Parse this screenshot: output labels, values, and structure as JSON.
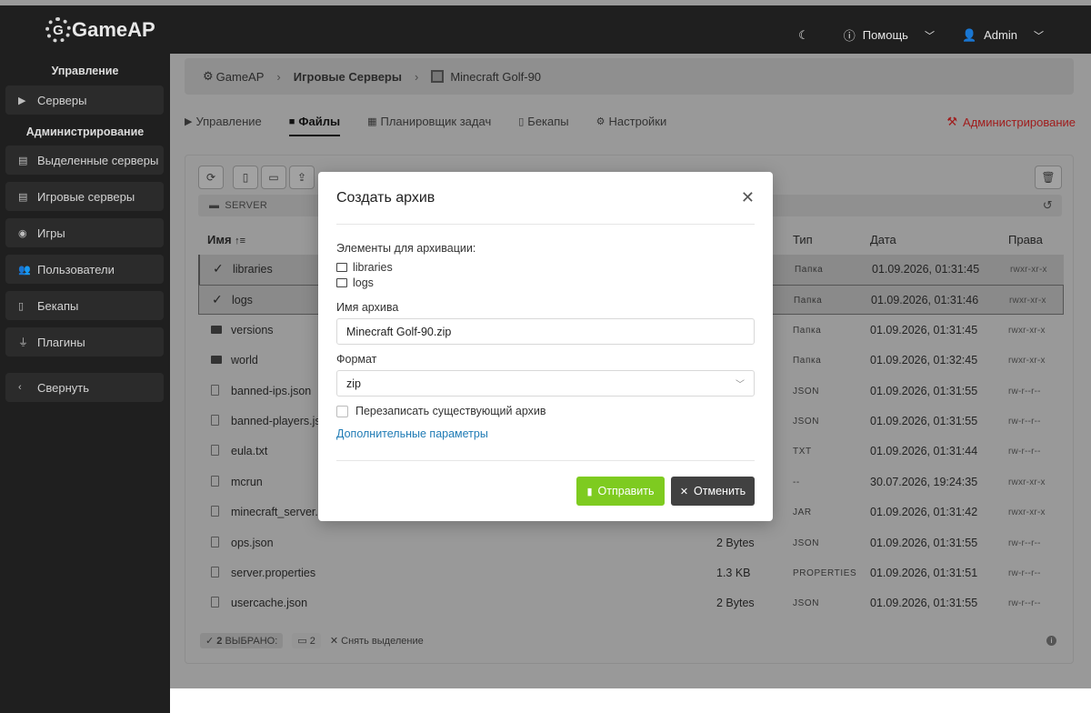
{
  "header": {
    "logo_text": "GameAP",
    "logo_glyph": "G",
    "help_label": "Помощь",
    "user_label": "Admin",
    "icons": {
      "theme": "moon-icon",
      "help": "question-circle-icon",
      "user": "user-icon"
    }
  },
  "sidebar": {
    "section_manage": "Управление",
    "section_admin": "Администрирование",
    "items": [
      {
        "label": "Серверы",
        "icon": "play-icon"
      },
      {
        "label": "Выделенные серверы",
        "icon": "server-icon"
      },
      {
        "label": "Игровые серверы",
        "icon": "server-icon"
      },
      {
        "label": "Игры",
        "icon": "gamepad-icon"
      },
      {
        "label": "Пользователи",
        "icon": "users-icon"
      },
      {
        "label": "Бекапы",
        "icon": "file-archive-icon"
      },
      {
        "label": "Плагины",
        "icon": "plug-icon"
      },
      {
        "label": "Свернуть",
        "icon": "chevron-left-icon"
      }
    ]
  },
  "breadcrumb": {
    "items": [
      "GameAP",
      "Игровые Серверы",
      "Minecraft Golf-90"
    ]
  },
  "tabs": {
    "items": [
      "Управление",
      "Файлы",
      "Планировщик задач",
      "Бекапы",
      "Настройки"
    ],
    "active": "Файлы",
    "admin": "Администрирование"
  },
  "file_manager": {
    "path": "SERVER",
    "columns": {
      "name": "Имя",
      "type": "Тип",
      "date": "Дата",
      "perms": "Права"
    },
    "rows": [
      {
        "name": "libraries",
        "size": "",
        "type": "Папка",
        "date": "01.09.2026, 01:31:45",
        "perms": "rwxr-xr-x",
        "kind": "folder",
        "selected": true
      },
      {
        "name": "logs",
        "size": "",
        "type": "Папка",
        "date": "01.09.2026, 01:31:46",
        "perms": "rwxr-xr-x",
        "kind": "folder",
        "selected": true
      },
      {
        "name": "versions",
        "size": "",
        "type": "Папка",
        "date": "01.09.2026, 01:31:45",
        "perms": "rwxr-xr-x",
        "kind": "folder",
        "selected": false
      },
      {
        "name": "world",
        "size": "",
        "type": "Папка",
        "date": "01.09.2026, 01:32:45",
        "perms": "rwxr-xr-x",
        "kind": "folder",
        "selected": false
      },
      {
        "name": "banned-ips.json",
        "size": "",
        "type": "JSON",
        "date": "01.09.2026, 01:31:55",
        "perms": "rw-r--r--",
        "kind": "file",
        "selected": false
      },
      {
        "name": "banned-players.js",
        "size": "",
        "type": "JSON",
        "date": "01.09.2026, 01:31:55",
        "perms": "rw-r--r--",
        "kind": "file",
        "selected": false
      },
      {
        "name": "eula.txt",
        "size": "",
        "type": "TXT",
        "date": "01.09.2026, 01:31:44",
        "perms": "rw-r--r--",
        "kind": "file",
        "selected": false
      },
      {
        "name": "mcrun",
        "size": "",
        "type": "--",
        "date": "30.07.2026, 19:24:35",
        "perms": "rwxr-xr-x",
        "kind": "file",
        "selected": false
      },
      {
        "name": "minecraft_server.",
        "size": "",
        "type": "JAR",
        "date": "01.09.2026, 01:31:42",
        "perms": "rwxr-xr-x",
        "kind": "file",
        "selected": false
      },
      {
        "name": "ops.json",
        "size": "2 Bytes",
        "type": "JSON",
        "date": "01.09.2026, 01:31:55",
        "perms": "rw-r--r--",
        "kind": "file",
        "selected": false
      },
      {
        "name": "server.properties",
        "size": "1.3 KB",
        "type": "PROPERTIES",
        "date": "01.09.2026, 01:31:51",
        "perms": "rw-r--r--",
        "kind": "file",
        "selected": false
      },
      {
        "name": "usercache.json",
        "size": "2 Bytes",
        "type": "JSON",
        "date": "01.09.2026, 01:31:55",
        "perms": "rw-r--r--",
        "kind": "file",
        "selected": false
      }
    ],
    "footer": {
      "selected_count": "2",
      "selected_label": "ВЫБРАНО:",
      "folder_count": "2",
      "clear_label": "Снять выделение"
    }
  },
  "modal": {
    "title": "Создать архив",
    "elements_label": "Элементы для архивации:",
    "elements": [
      "libraries",
      "logs"
    ],
    "name_label": "Имя архива",
    "name_value": "Minecraft Golf-90.zip",
    "format_label": "Формат",
    "format_value": "zip",
    "overwrite_label": "Перезаписать существующий архив",
    "advanced_link": "Дополнительные параметры",
    "submit_label": "Отправить",
    "cancel_label": "Отменить",
    "colors": {
      "submit": "#7ecb20",
      "cancel": "#414141",
      "link": "#1f7bb5"
    }
  }
}
